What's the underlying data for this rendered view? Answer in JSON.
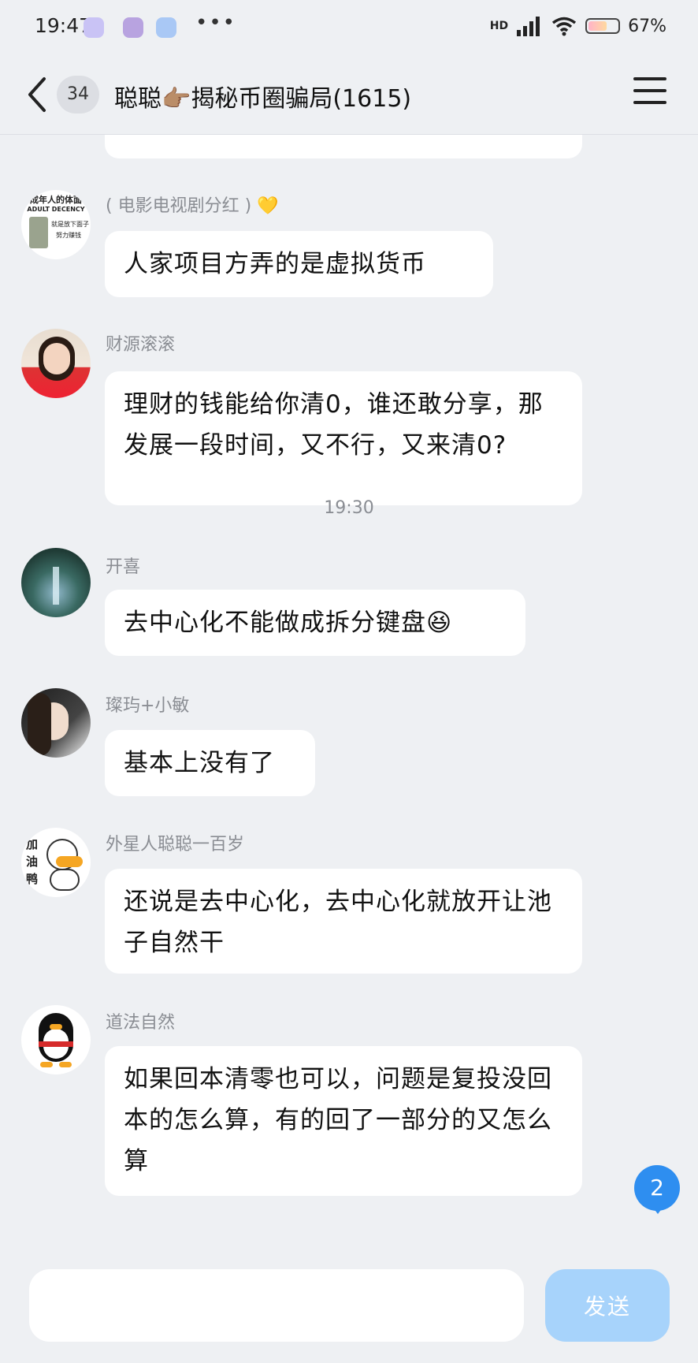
{
  "status_bar": {
    "time": "19:47",
    "dots": "•••",
    "network": "HD",
    "battery": "67%",
    "battery_level": 0.67
  },
  "header": {
    "unread_count": "34",
    "title": "聪聪👉🏽揭秘币圈骗局(1615)"
  },
  "messages": [
    {
      "sender": "( 电影电视剧分红 ) 💛",
      "text": "人家项目方弄的是虚拟货币"
    },
    {
      "sender": "财源滚滚",
      "text": "理财的钱能给你清0，谁还敢分享，那发展一段时间，又不行，又来清0?"
    },
    {
      "sender": "开喜",
      "text": "去中心化不能做成拆分键盘😆"
    },
    {
      "sender": "璨玙+小敏",
      "text": "基本上没有了"
    },
    {
      "sender": "外星人聪聪一百岁",
      "text": "还说是去中心化，去中心化就放开让池子自然干"
    },
    {
      "sender": "道法自然",
      "text": "如果回本清零也可以，问题是复投没回本的怎么算，有的回了一部分的又怎么算"
    }
  ],
  "time_divider": "19:30",
  "avatar_texts": {
    "first": [
      "成年人的体面",
      "ADULT DECENCY",
      "就是放下面子",
      "努力赚钱"
    ],
    "duck": [
      "加",
      "油",
      "鸭"
    ]
  },
  "floating_badge": "2",
  "input": {
    "value": "",
    "send_label": "发送"
  },
  "colors": {
    "accent": "#2e8ef0",
    "send_button": "#a7d3fb",
    "background": "#eef0f3"
  }
}
